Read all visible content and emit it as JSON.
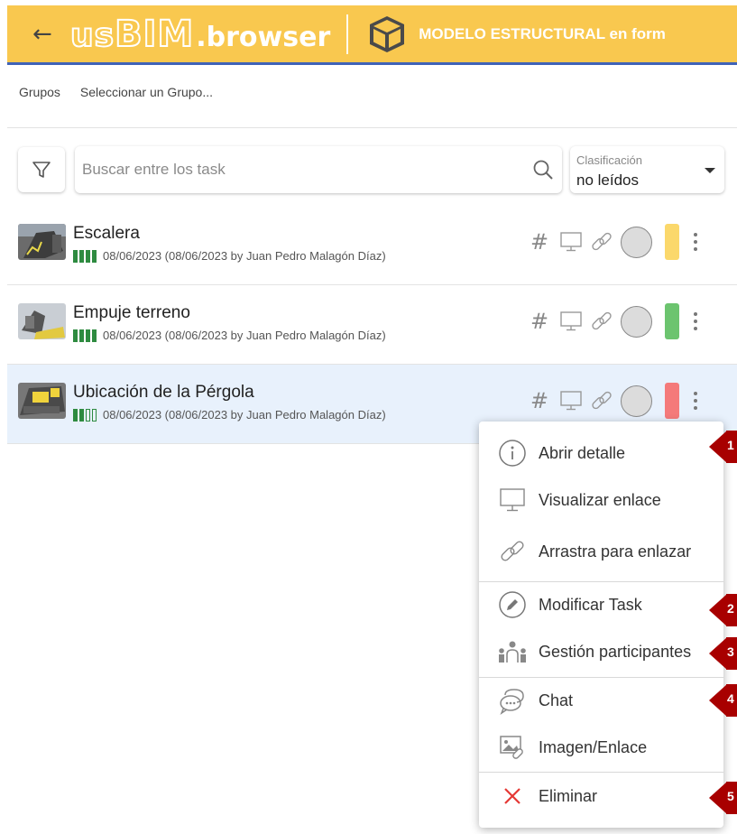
{
  "header": {
    "back_label": "←",
    "logo_us": "us",
    "logo_bim": "BIM",
    "logo_browser": ".browser",
    "model_title": "MODELO ESTRUCTURAL en form"
  },
  "breadcrumb": {
    "groups_label": "Grupos",
    "select_group_label": "Seleccionar un Grupo..."
  },
  "toolbar": {
    "search_placeholder": "Buscar entre los task",
    "sort_label": "Clasificación",
    "sort_value": "no leídos"
  },
  "tasks": [
    {
      "title": "Escalera",
      "meta": "08/06/2023 (08/06/2023 by Juan Pedro Malagón Díaz)",
      "progress_filled": 4,
      "progress_total": 4,
      "status_color": "#fbd86b",
      "selected": false
    },
    {
      "title": "Empuje terreno",
      "meta": "08/06/2023 (08/06/2023 by Juan Pedro Malagón Díaz)",
      "progress_filled": 4,
      "progress_total": 4,
      "status_color": "#6cc46f",
      "selected": false
    },
    {
      "title": "Ubicación de la Pérgola",
      "meta": "08/06/2023 (08/06/2023 by Juan Pedro Malagón Díaz)",
      "progress_filled": 2,
      "progress_total": 4,
      "status_color": "#f47a7a",
      "selected": true
    }
  ],
  "row_hash": "#",
  "context_menu": {
    "items": [
      {
        "label": "Abrir detalle",
        "icon": "info-icon"
      },
      {
        "label": "Visualizar enlace",
        "icon": "monitor-icon"
      },
      {
        "label": "Arrastra para enlazar",
        "icon": "link-icon"
      },
      {
        "label": "Modificar Task",
        "icon": "pencil-icon"
      },
      {
        "label": "Gestión participantes",
        "icon": "participants-icon"
      },
      {
        "label": "Chat",
        "icon": "chat-icon"
      },
      {
        "label": "Imagen/Enlace",
        "icon": "image-link-icon"
      },
      {
        "label": "Eliminar",
        "icon": "close-icon"
      }
    ]
  },
  "callouts": [
    "1",
    "2",
    "3",
    "4",
    "5"
  ],
  "colors": {
    "header_bg": "#f9c84f",
    "header_border": "#3f63b8",
    "selected_row_bg": "#e8f1fc",
    "callout": "#a80000",
    "delete_icon": "#e53935"
  }
}
